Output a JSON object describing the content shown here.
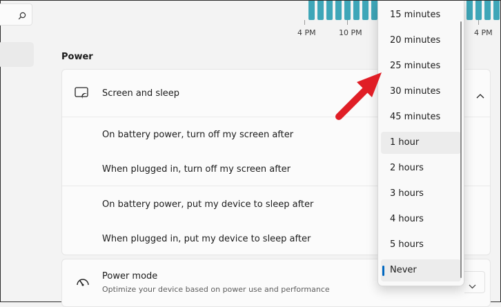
{
  "chart": {
    "tick_labels": [
      "4 PM",
      "10 PM",
      "4 PM"
    ]
  },
  "power": {
    "section_title": "Power",
    "screen_sleep": {
      "title": "Screen and sleep",
      "rows": [
        "On battery power, turn off my screen after",
        "When plugged in, turn off my screen after",
        "On battery power, put my device to sleep after",
        "When plugged in, put my device to sleep after"
      ]
    },
    "power_mode": {
      "title": "Power mode",
      "description": "Optimize your device based on power use and performance"
    }
  },
  "dropdown": {
    "options": [
      "15 minutes",
      "20 minutes",
      "25 minutes",
      "30 minutes",
      "45 minutes",
      "1 hour",
      "2 hours",
      "3 hours",
      "4 hours",
      "5 hours",
      "Never"
    ],
    "hovered": "1 hour",
    "selected": "Never"
  },
  "colors": {
    "accent": "#0067c0",
    "chart_bar": "#3ea6b8",
    "annotation_arrow": "#e01e26"
  }
}
